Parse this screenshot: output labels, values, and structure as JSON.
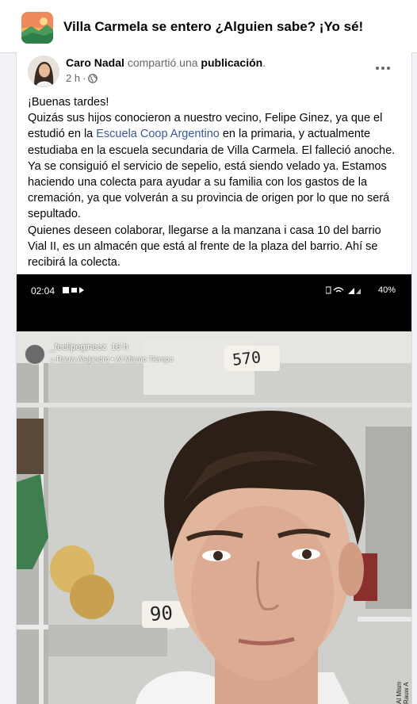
{
  "group": {
    "title": "Villa Carmela se entero ¿Alguien sabe? ¡Yo sé!"
  },
  "post": {
    "author": "Caro Nadal",
    "shared_text": "compartió una",
    "shared_link": "publicación",
    "shared_period": ".",
    "time": "2 h",
    "time_sep": "·",
    "privacy_icon": "globe-icon",
    "paragraphs": [
      "¡Buenas tardes!",
      {
        "before": "Quizás sus hijos conocieron a nuestro vecino, Felipe Ginez, ya que el estudió en la ",
        "link": "Escuela Coop Argentino",
        "after": " en la primaria, y actualmente estudiaba en la escuela secundaria de Villa Carmela. El falleció anoche. Ya se consiguió el servicio de sepelio, está siendo velado ya. Estamos haciendo una colecta para ayudar a su familia con los gastos de la cremación, ya que volverán a su provincia de origen por lo que no será sepultado."
      },
      "Quienes deseen colaborar, llegarse a la manzana i casa 10 del barrio Vial II, es un almacén que está al frente de la plaza del barrio. Ahí se recibirá la colecta."
    ]
  },
  "media": {
    "status_time": "02:04",
    "status_battery": "40%",
    "story_username": "_feelipegineez",
    "story_time": "16 h",
    "story_music": "Rauw Alejandro • Al Mismo Tiempo",
    "box_label_top": "570",
    "box_label_bottom": "90",
    "side_text": "Al Mism Rauw A"
  },
  "colors": {
    "link": "#385898",
    "secondary": "#65676b",
    "background": "#f0f2f5"
  }
}
